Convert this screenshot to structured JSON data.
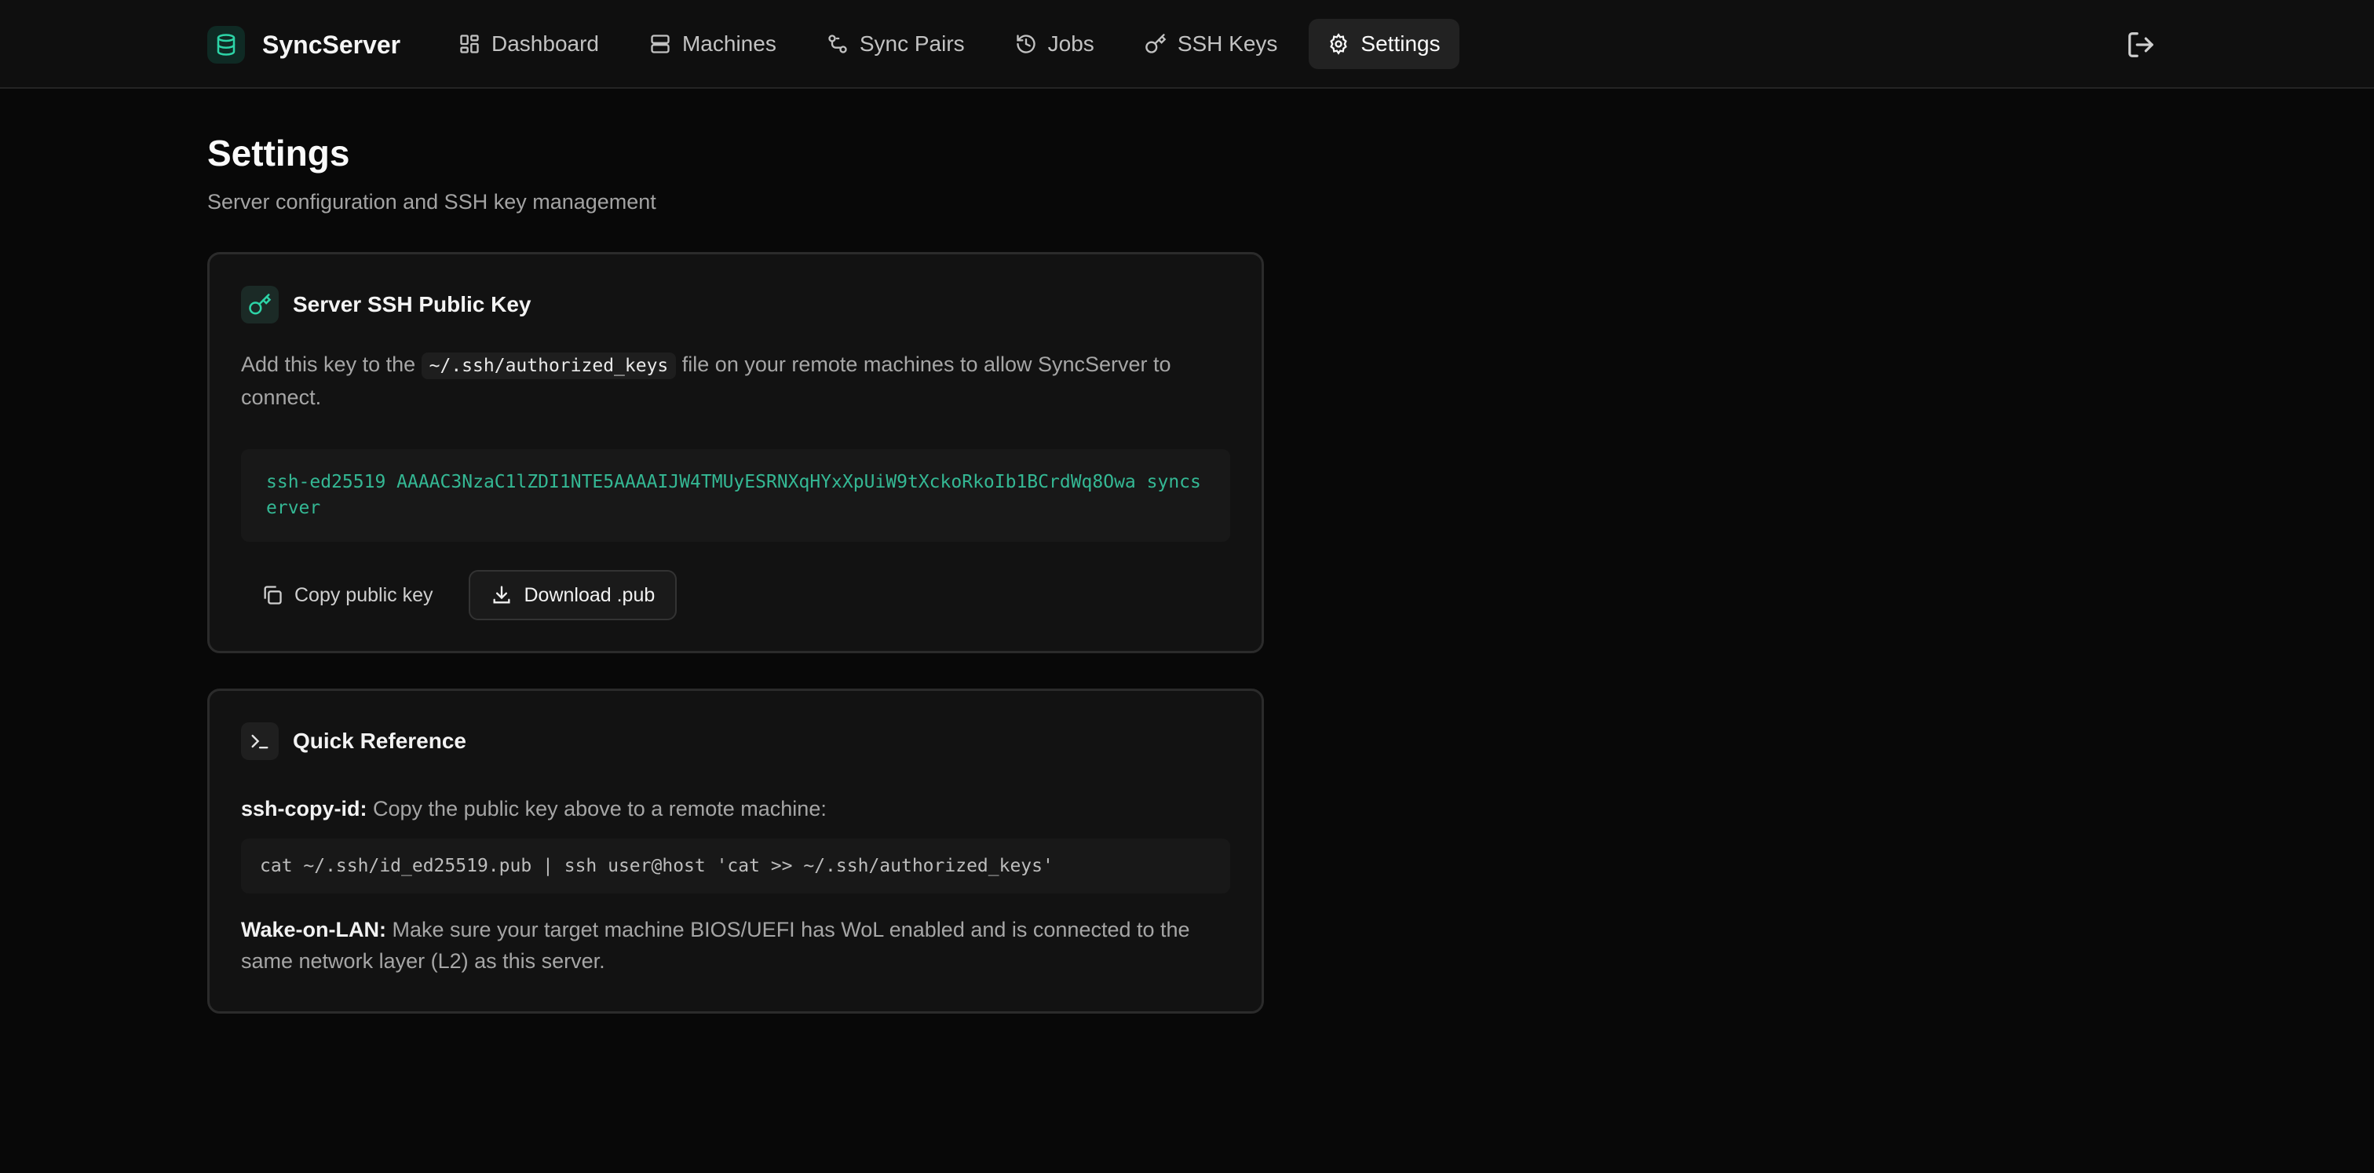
{
  "brand": {
    "name": "SyncServer",
    "icon": "database-icon",
    "accent": "#2dd4a7"
  },
  "nav": [
    {
      "label": "Dashboard",
      "icon": "dashboard-icon",
      "active": false
    },
    {
      "label": "Machines",
      "icon": "server-icon",
      "active": false
    },
    {
      "label": "Sync Pairs",
      "icon": "sync-pairs-icon",
      "active": false
    },
    {
      "label": "Jobs",
      "icon": "history-icon",
      "active": false
    },
    {
      "label": "SSH Keys",
      "icon": "key-icon",
      "active": false
    },
    {
      "label": "Settings",
      "icon": "gear-icon",
      "active": true
    }
  ],
  "header": {
    "logout_icon": "logout-icon"
  },
  "page": {
    "title": "Settings",
    "subtitle": "Server configuration and SSH key management"
  },
  "ssh_card": {
    "title": "Server SSH Public Key",
    "desc_before": "Add this key to the ",
    "desc_code": "~/.ssh/authorized_keys",
    "desc_after": " file on your remote machines to allow SyncServer to connect.",
    "public_key": "ssh-ed25519 AAAAC3NzaC1lZDI1NTE5AAAAIJW4TMUyESRNXqHYxXpUiW9tXckoRkoIb1BCrdWq8Owa syncserver",
    "copy_label": "Copy public key",
    "download_label": "Download .pub"
  },
  "ref_card": {
    "title": "Quick Reference",
    "copy_id_label": "ssh-copy-id:",
    "copy_id_text": " Copy the public key above to a remote machine:",
    "command": "cat ~/.ssh/id_ed25519.pub | ssh user@host 'cat >> ~/.ssh/authorized_keys'",
    "wol_label": "Wake-on-LAN:",
    "wol_text": " Make sure your target machine BIOS/UEFI has WoL enabled and is connected to the same network layer (L2) as this server."
  }
}
